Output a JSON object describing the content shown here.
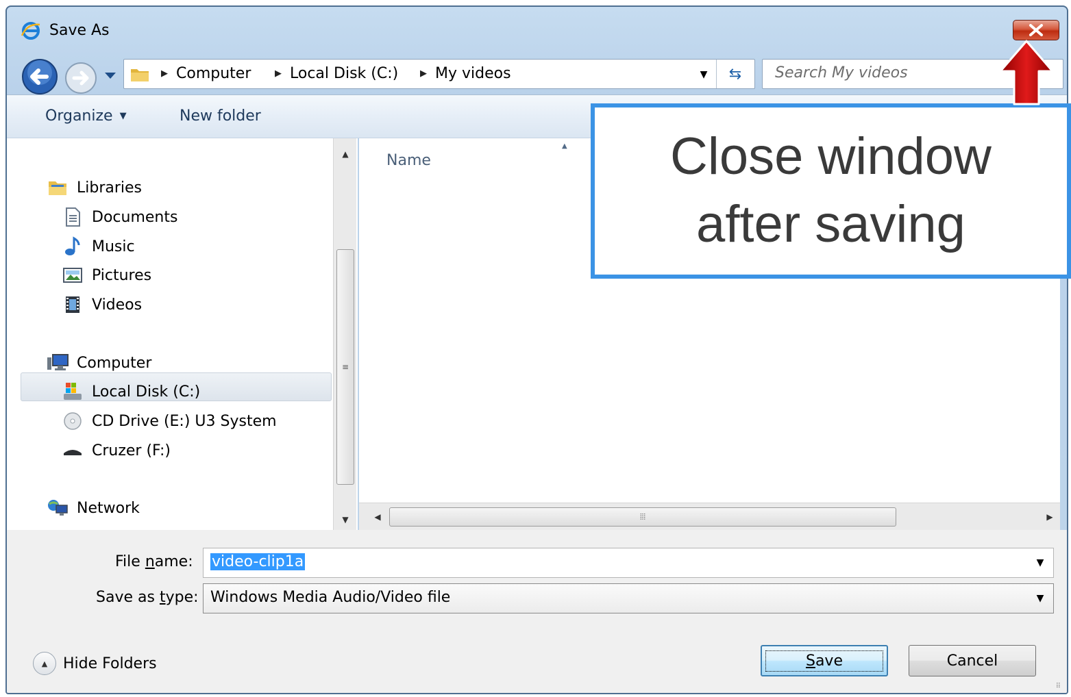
{
  "window": {
    "title": "Save As"
  },
  "navigation": {
    "breadcrumbs": [
      "Computer",
      "Local Disk (C:)",
      "My videos"
    ],
    "search_placeholder": "Search My videos"
  },
  "toolbar": {
    "organize": "Organize",
    "new_folder": "New folder"
  },
  "nav_pane": {
    "libraries": {
      "label": "Libraries",
      "items": [
        "Documents",
        "Music",
        "Pictures",
        "Videos"
      ]
    },
    "computer": {
      "label": "Computer",
      "items": [
        "Local Disk (C:)",
        "CD Drive (E:) U3 System",
        "Cruzer (F:)"
      ]
    },
    "network": {
      "label": "Network"
    },
    "selected": "Local Disk (C:)"
  },
  "content": {
    "column_name": "Name"
  },
  "form": {
    "file_name_label_pre": "File ",
    "file_name_label_u": "n",
    "file_name_label_post": "ame:",
    "file_name_value": "video-clip1a",
    "save_type_label_pre": "Save as ",
    "save_type_label_u": "t",
    "save_type_label_post": "ype:",
    "save_type_value": "Windows Media Audio/Video file"
  },
  "footer": {
    "hide_folders": "Hide Folders",
    "save_u": "S",
    "save_rest": "ave",
    "cancel": "Cancel"
  },
  "annotation": {
    "line1": "Close window",
    "line2": "after saving"
  },
  "colors": {
    "callout_border": "#3b93e5",
    "arrow": "#cc0000",
    "selection": "#3399ff"
  }
}
